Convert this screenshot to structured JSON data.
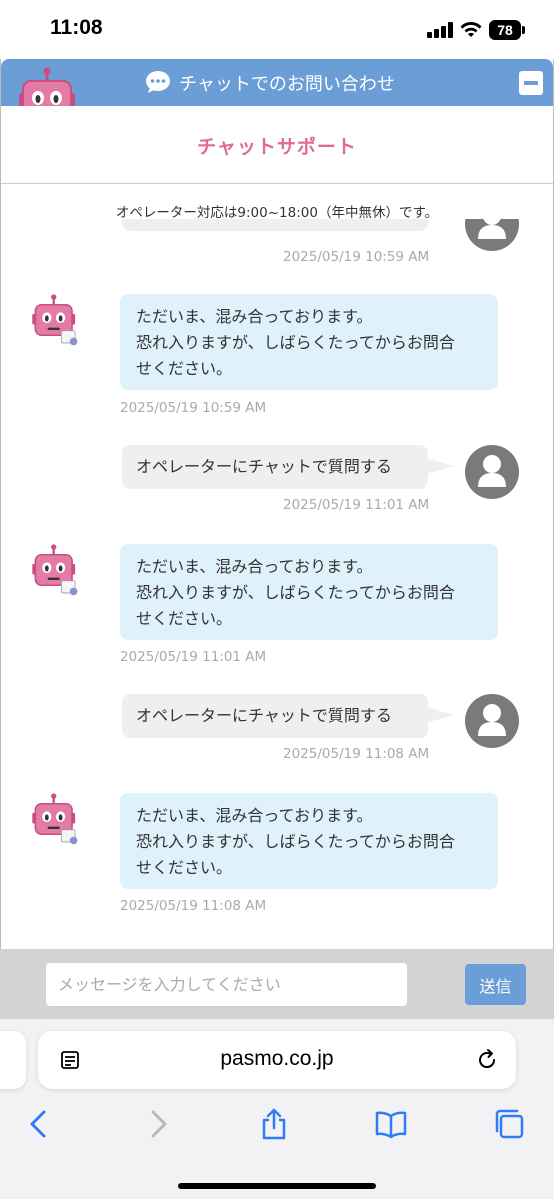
{
  "status_bar": {
    "time": "11:08",
    "battery": "78"
  },
  "chat": {
    "header_title": "チャットでのお問い合わせ",
    "support_title": "チャットサポート",
    "notice": "オペレーター対応は9:00~18:00（年中無休）です。",
    "messages": [
      {
        "sender": "user",
        "partial": true,
        "timestamp": "2025/05/19 10:59 AM"
      },
      {
        "sender": "bot",
        "lines": [
          "ただいま、混み合っております。",
          "恐れ入りますが、しばらくたってからお問合",
          "せください。"
        ],
        "timestamp": "2025/05/19 10:59 AM"
      },
      {
        "sender": "user",
        "text": "オペレーターにチャットで質問する",
        "timestamp": "2025/05/19 11:01 AM"
      },
      {
        "sender": "bot",
        "lines": [
          "ただいま、混み合っております。",
          "恐れ入りますが、しばらくたってからお問合",
          "せください。"
        ],
        "timestamp": "2025/05/19 11:01 AM"
      },
      {
        "sender": "user",
        "text": "オペレーターにチャットで質問する",
        "timestamp": "2025/05/19 11:08 AM"
      },
      {
        "sender": "bot",
        "lines": [
          "ただいま、混み合っております。",
          "恐れ入りますが、しばらくたってからお問合",
          "せください。"
        ],
        "timestamp": "2025/05/19 11:08 AM"
      }
    ],
    "input_placeholder": "メッセージを入力してください",
    "send_label": "送信"
  },
  "browser": {
    "url": "pasmo.co.jp"
  },
  "colors": {
    "header_blue": "#6b9dd6",
    "brand_pink": "#e0689b",
    "bot_bubble": "#dff1fb",
    "user_bubble": "#efefef"
  },
  "icons": [
    "signal-icon",
    "wifi-icon",
    "battery-icon",
    "chat-bubble-icon",
    "minimize-icon",
    "robot-icon",
    "user-avatar-icon",
    "reader-icon",
    "reload-icon",
    "back-icon",
    "forward-icon",
    "share-icon",
    "bookmarks-icon",
    "tabs-icon"
  ]
}
